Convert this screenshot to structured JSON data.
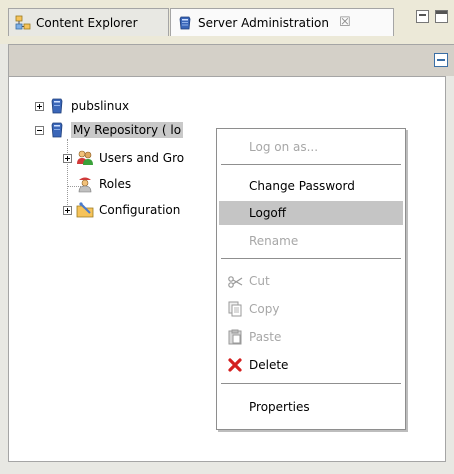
{
  "tabs": [
    {
      "label": "Content Explorer",
      "icon": "content-explorer-icon"
    },
    {
      "label": "Server Administration",
      "icon": "server-admin-icon",
      "close_glyph": "☒"
    }
  ],
  "view_controls": {
    "minimize_icon": "minimize-icon",
    "maximize_icon": "maximize-icon"
  },
  "toolbar": {
    "collapse_icon": "collapse-all-icon"
  },
  "tree": {
    "items": [
      {
        "label": "pubslinux",
        "expander": "plus",
        "icon": "server-icon"
      },
      {
        "label": "My Repository ( localhost )",
        "visible_label": "My Repository ( lo",
        "expander": "minus",
        "icon": "server-icon",
        "selected": true
      },
      {
        "label": "Users and Gro",
        "expander": "plus",
        "icon": "users-icon"
      },
      {
        "label": "Roles",
        "expander": null,
        "icon": "roles-icon"
      },
      {
        "label": "Configuration",
        "expander": "plus",
        "icon": "configuration-icon"
      }
    ]
  },
  "context_menu": {
    "items": [
      {
        "label": "Log on as...",
        "disabled": true,
        "highlighted": false
      },
      {
        "label": "Change Password",
        "disabled": false,
        "highlighted": false
      },
      {
        "label": "Logoff",
        "disabled": false,
        "highlighted": true
      },
      {
        "label": "Rename",
        "disabled": true,
        "highlighted": false
      },
      {
        "label": "Cut",
        "disabled": true,
        "highlighted": false,
        "icon": "scissors-icon"
      },
      {
        "label": "Copy",
        "disabled": true,
        "highlighted": false,
        "icon": "copy-icon"
      },
      {
        "label": "Paste",
        "disabled": true,
        "highlighted": false,
        "icon": "paste-icon"
      },
      {
        "label": "Delete",
        "disabled": false,
        "highlighted": false,
        "icon": "delete-icon"
      },
      {
        "label": "Properties",
        "disabled": false,
        "highlighted": false
      }
    ]
  },
  "colors": {
    "frame_bg": "#e8e8e3",
    "selection_bg": "#c5c5c5",
    "disabled_text": "#a7a7a7",
    "delete_red": "#d42020"
  }
}
